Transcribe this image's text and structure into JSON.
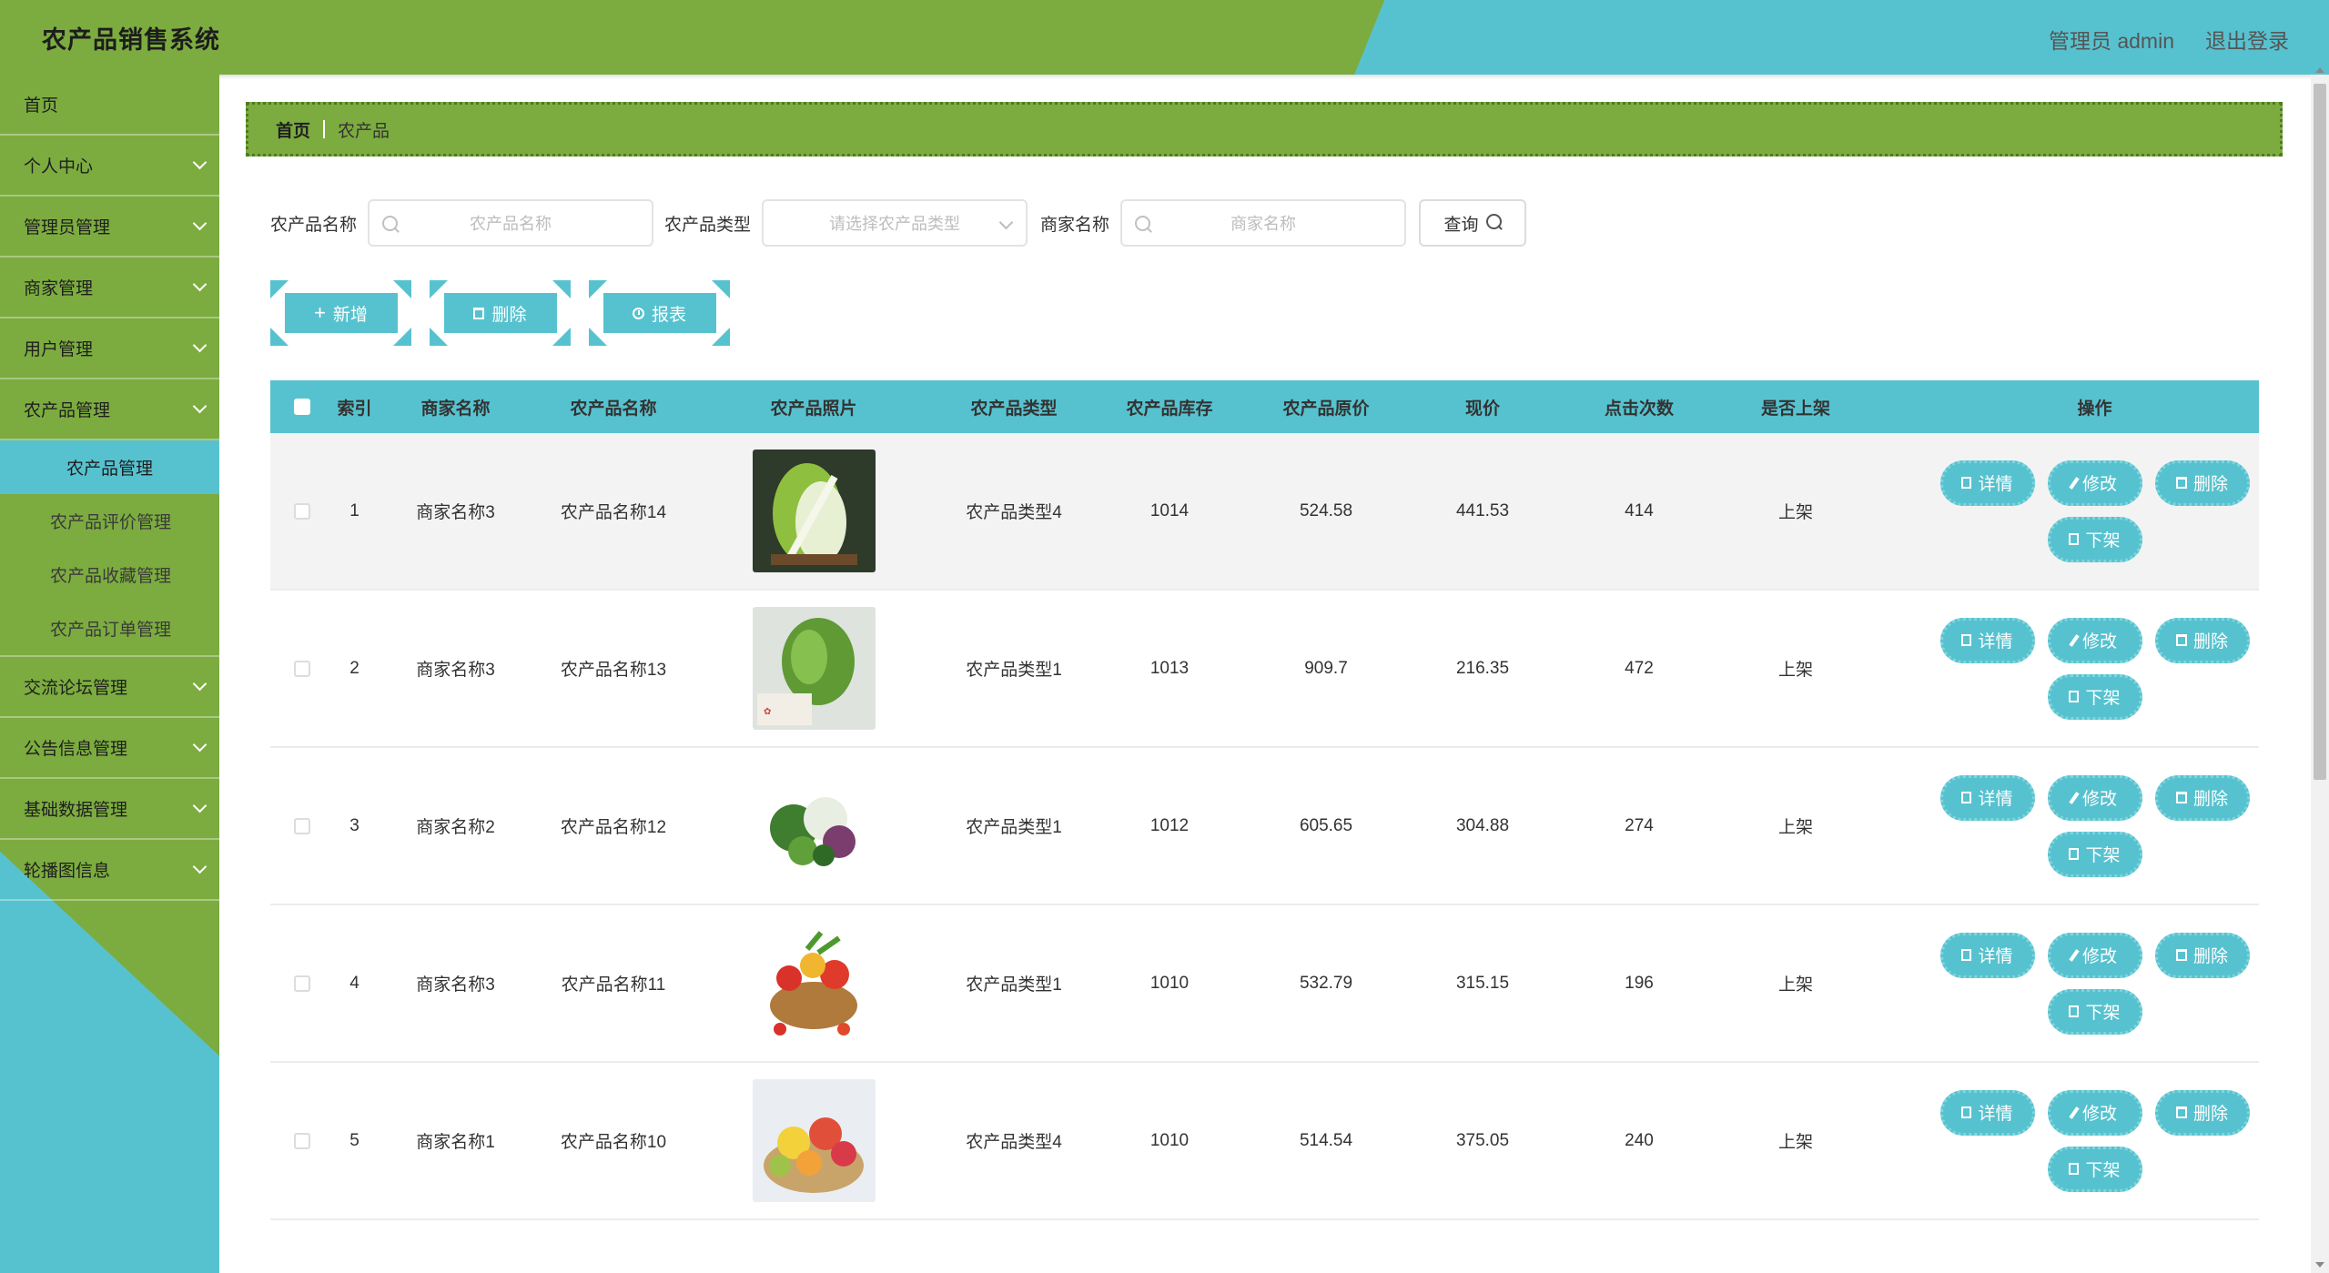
{
  "header": {
    "title": "农产品销售系统",
    "user": "管理员 admin",
    "logout": "退出登录"
  },
  "sidebar": {
    "home": "首页",
    "personal": "个人中心",
    "admin_mgmt": "管理员管理",
    "merchant_mgmt": "商家管理",
    "user_mgmt": "用户管理",
    "product_mgmt": "农产品管理",
    "sub_items": [
      "农产品管理",
      "农产品评价管理",
      "农产品收藏管理",
      "农产品订单管理"
    ],
    "forum": "交流论坛管理",
    "notice": "公告信息管理",
    "basic_data": "基础数据管理",
    "carousel": "轮播图信息"
  },
  "breadcrumb": {
    "home": "首页",
    "current": "农产品"
  },
  "search": {
    "name_label": "农产品名称",
    "name_placeholder": "农产品名称",
    "type_label": "农产品类型",
    "type_placeholder": "请选择农产品类型",
    "shop_label": "商家名称",
    "shop_placeholder": "商家名称",
    "query": "查询"
  },
  "actions": {
    "add": "新增",
    "delete": "删除",
    "report": "报表"
  },
  "table": {
    "headers": [
      "索引",
      "商家名称",
      "农产品名称",
      "农产品照片",
      "农产品类型",
      "农产品库存",
      "农产品原价",
      "现价",
      "点击次数",
      "是否上架",
      "操作"
    ],
    "ops": {
      "detail": "详情",
      "edit": "修改",
      "delete": "删除",
      "off_shelf": "下架"
    },
    "rows": [
      {
        "index": "1",
        "shop": "商家名称3",
        "name": "农产品名称14",
        "photo": "cabbage-bok-choy",
        "type": "农产品类型4",
        "stock": "1014",
        "price": "524.58",
        "now": "441.53",
        "clicks": "414",
        "shelf": "上架"
      },
      {
        "index": "2",
        "shop": "商家名称3",
        "name": "农产品名称13",
        "photo": "cabbage",
        "type": "农产品类型1",
        "stock": "1013",
        "price": "909.7",
        "now": "216.35",
        "clicks": "472",
        "shelf": "上架"
      },
      {
        "index": "3",
        "shop": "商家名称2",
        "name": "农产品名称12",
        "photo": "vegetable-mix",
        "type": "农产品类型1",
        "stock": "1012",
        "price": "605.65",
        "now": "304.88",
        "clicks": "274",
        "shelf": "上架"
      },
      {
        "index": "4",
        "shop": "商家名称3",
        "name": "农产品名称11",
        "photo": "vegetable-basket",
        "type": "农产品类型1",
        "stock": "1010",
        "price": "532.79",
        "now": "315.15",
        "clicks": "196",
        "shelf": "上架"
      },
      {
        "index": "5",
        "shop": "商家名称1",
        "name": "农产品名称10",
        "photo": "fruit-bowl",
        "type": "农产品类型4",
        "stock": "1010",
        "price": "514.54",
        "now": "375.05",
        "clicks": "240",
        "shelf": "上架"
      }
    ]
  },
  "colors": {
    "green": "#7cac3f",
    "teal": "#57c2cf"
  }
}
